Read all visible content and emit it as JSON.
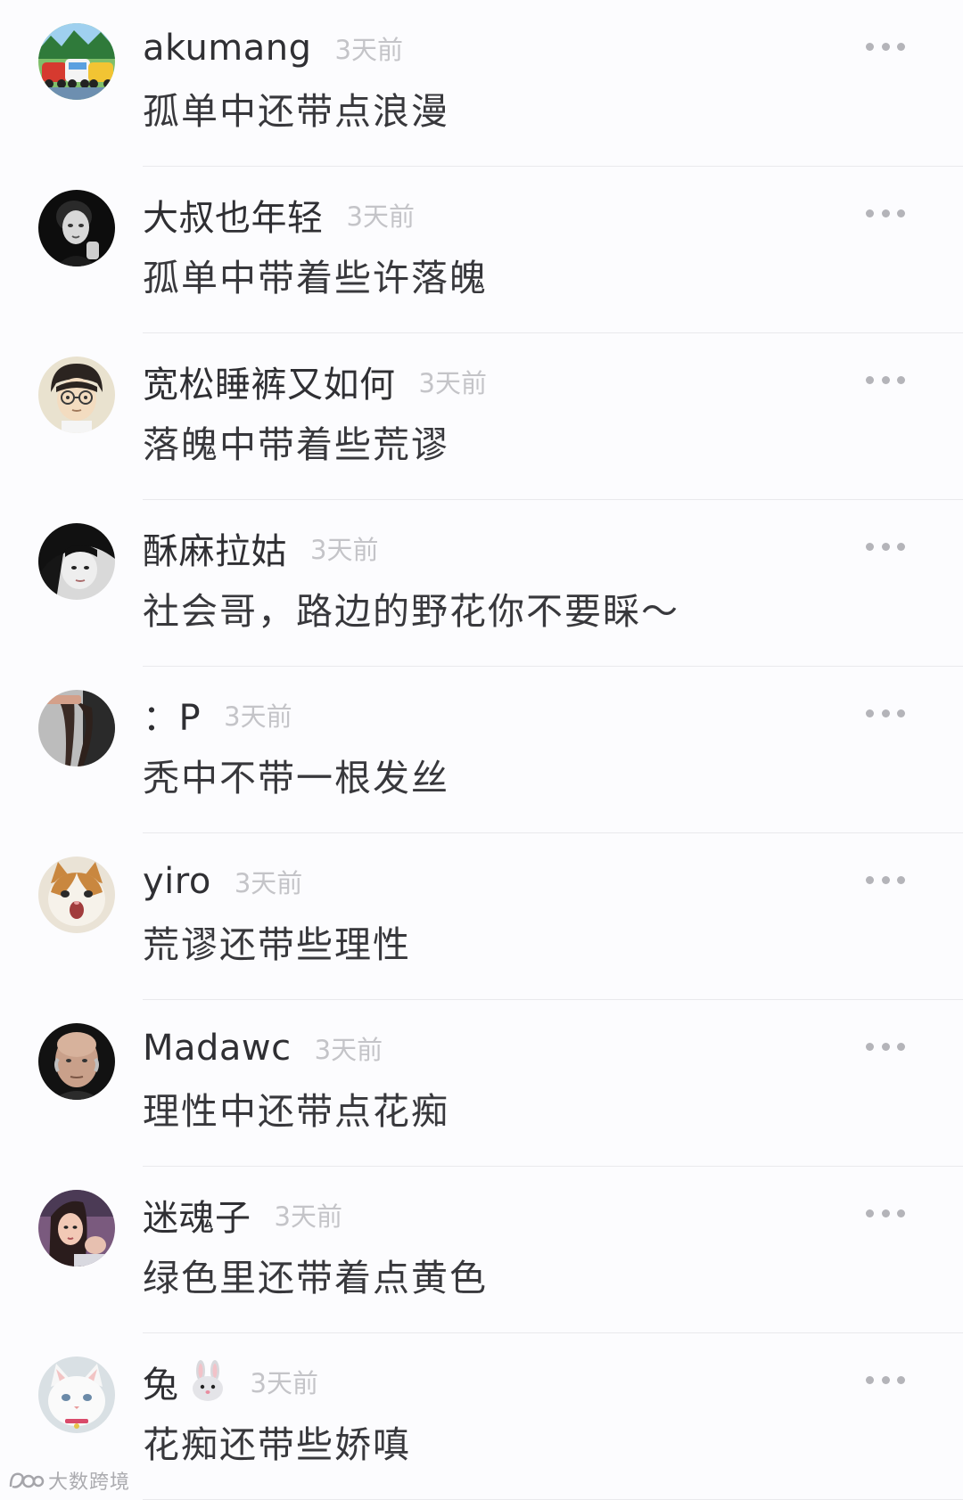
{
  "comments": [
    {
      "username": "akumang",
      "time": "3天前",
      "text": "孤单中还带点浪漫",
      "avatar": "robocar-poli-avatar"
    },
    {
      "username": "大叔也年轻",
      "time": "3天前",
      "text": "孤单中带着些许落魄",
      "avatar": "man-portrait-bw-avatar"
    },
    {
      "username": "宽松睡裤又如何",
      "time": "3天前",
      "text": "落魄中带着些荒谬",
      "avatar": "anime-boy-glasses-avatar"
    },
    {
      "username": "酥麻拉姑",
      "time": "3天前",
      "text": "社会哥，路边的野花你不要睬～",
      "avatar": "woman-dark-hair-avatar"
    },
    {
      "username": "：P",
      "time": "3天前",
      "text": "秃中不带一根发丝",
      "avatar": "legs-photo-avatar"
    },
    {
      "username": "yiro",
      "time": "3天前",
      "text": "荒谬还带些理性",
      "avatar": "screaming-cat-avatar"
    },
    {
      "username": "Madawc",
      "time": "3天前",
      "text": "理性中还带点花痴",
      "avatar": "bald-man-avatar"
    },
    {
      "username": "迷魂子",
      "time": "3天前",
      "text": "绿色里还带着点黄色",
      "avatar": "woman-selfie-avatar"
    },
    {
      "username": "兔",
      "username_emoji": "rabbit-face-emoji",
      "time": "3天前",
      "text": "花痴还带些娇嗔",
      "avatar": "white-cat-avatar"
    }
  ],
  "watermark": {
    "text": "大数跨境",
    "logo": "dashu-logo"
  },
  "colors": {
    "background": "#fcfcfe",
    "username": "#2f2f33",
    "timestamp": "#c4c4c8",
    "text": "#38383c",
    "divider": "#e9e9ec",
    "more_dots": "#b4b4b9"
  }
}
